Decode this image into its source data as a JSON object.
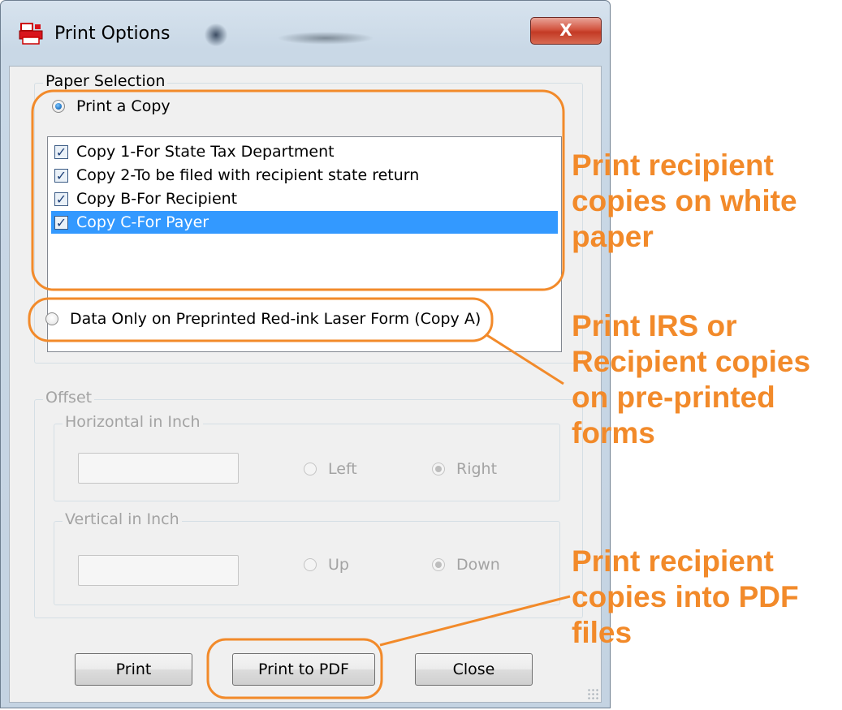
{
  "window": {
    "title": "Print Options",
    "close_glyph": "X",
    "icon": "printer-red-icon"
  },
  "paper_selection": {
    "label": "Paper Selection",
    "print_copy_label": "Print a Copy",
    "print_copy_checked": true,
    "copies": [
      {
        "label": "Copy 1-For State Tax Department",
        "checked": true,
        "selected": false
      },
      {
        "label": "Copy 2-To be filed with recipient state return",
        "checked": true,
        "selected": false
      },
      {
        "label": "Copy B-For Recipient",
        "checked": true,
        "selected": false
      },
      {
        "label": "Copy C-For Payer",
        "checked": true,
        "selected": true
      }
    ],
    "data_only_label": "Data Only on Preprinted Red-ink Laser Form (Copy A)",
    "data_only_checked": false
  },
  "offset": {
    "label": "Offset",
    "horizontal": {
      "label": "Horizontal in Inch",
      "value": "",
      "option_left": "Left",
      "option_right": "Right",
      "selected": "Right"
    },
    "vertical": {
      "label": "Vertical in Inch",
      "value": "",
      "option_up": "Up",
      "option_down": "Down",
      "selected": "Down"
    }
  },
  "buttons": {
    "print": "Print",
    "print_pdf": "Print to PDF",
    "close": "Close"
  },
  "annotations": {
    "white_paper": "Print recipient\ncopies on white\npaper",
    "preprinted": "Print IRS or\nRecipient copies\non pre-printed\nforms",
    "pdf": "Print recipient\ncopies into PDF\nfiles"
  },
  "colors": {
    "annotation": "#f28a2a",
    "selection": "#3399ff"
  }
}
